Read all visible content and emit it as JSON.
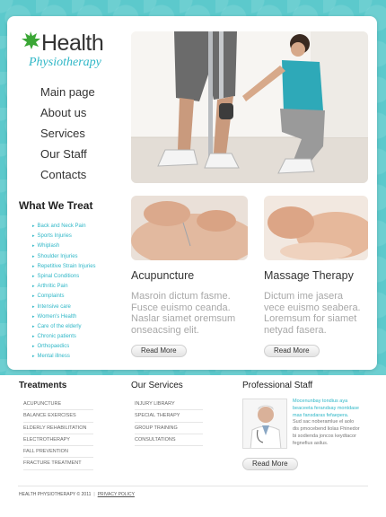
{
  "brand": {
    "name_line1": "Health",
    "name_line2": "Physiotherapy",
    "accent_color": "#2fb7c7",
    "leaf_color": "#3aa635"
  },
  "main_nav": [
    "Main page",
    "About us",
    "Services",
    "Our Staff",
    "Contacts"
  ],
  "treat": {
    "title": "What We Treat",
    "items": [
      "Back and Neck Pain",
      "Sports Injuries",
      "Whiplash",
      "Shoulder Injuries",
      "Repetitive Strain Injuries",
      "Spinal Conditions",
      "Arthritic Pain",
      "Complaints",
      "Intensive care",
      "Women's Health",
      "Care of the elderly",
      "Chronic patients",
      "Orthopaedics",
      "Mental illness"
    ]
  },
  "features": [
    {
      "title": "Acupuncture",
      "text": [
        "Masroin dictum fasme.",
        "Fusce euismo ceanda.",
        "Naslar siamet oremsum",
        "onseacsing elit."
      ],
      "button": "Read More"
    },
    {
      "title": "Massage Therapy",
      "text": [
        "Dictum ime jasera",
        "vece euismo seabera.",
        "Loremsum for siamet",
        "netyad fasera."
      ],
      "button": "Read More"
    }
  ],
  "treatments": {
    "title": "Treatments",
    "items": [
      "ACUPUNCTURE",
      "BALANCE EXERCISES",
      "ELDERLY REHABILITATION",
      "ELECTROTHERAPY",
      "FALL PREVENTION",
      "FRACTURE TREATMENT"
    ]
  },
  "services": {
    "title": "Our Services",
    "items": [
      "INJURY LIBRARY",
      "SPECIAL THERAPY",
      "GROUP TRAINING",
      "CONSULTATIONS"
    ]
  },
  "staff": {
    "title": "Professional Staff",
    "highlight": [
      "Mocenunbay tondius aya",
      "beaceeta ferandsay montdase",
      "mas fansdaras fefaepera."
    ],
    "normal": [
      "Sud sac noberamlue el aolo",
      "dis pmocebend liolas Fhinedor",
      "bi sodienda joncos keydtacor",
      "fegnefius asilus."
    ],
    "button": "Read More"
  },
  "footer": {
    "copyright": "HEALTH PHYSIOTHERAPY © 2011",
    "separator": "|",
    "privacy": "PRIVACY POLICY"
  }
}
